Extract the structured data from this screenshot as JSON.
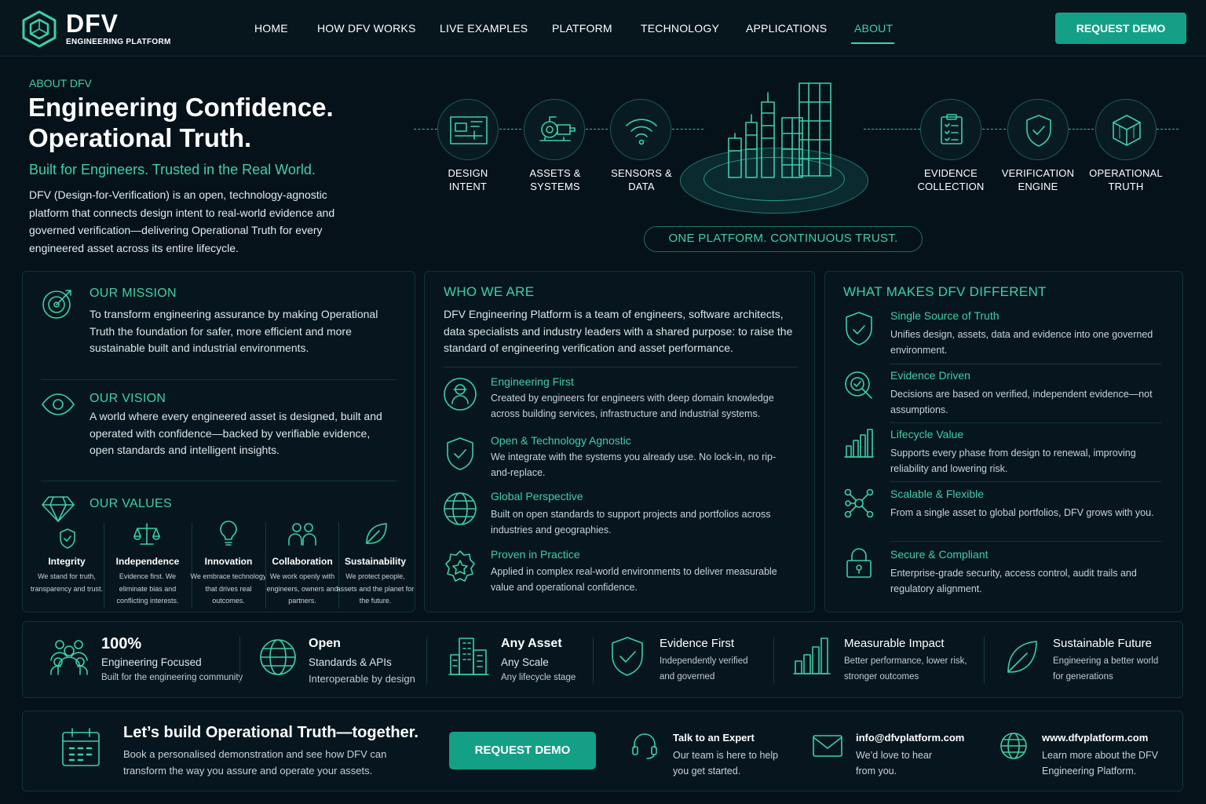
{
  "header": {
    "brand": "DFV",
    "brand_sub": "ENGINEERING PLATFORM",
    "nav": [
      "HOME",
      "HOW DFV WORKS",
      "LIVE EXAMPLES",
      "PLATFORM",
      "TECHNOLOGY",
      "APPLICATIONS",
      "ABOUT"
    ],
    "active_nav": "ABOUT",
    "demo_label": "REQUEST DEMO"
  },
  "hero": {
    "eyebrow": "ABOUT DFV",
    "title_line1": "Engineering Confidence.",
    "title_line2": "Operational Truth.",
    "tagline": "Built for Engineers. Trusted in the Real World.",
    "intro": "DFV (Design-for-Verification) is an open, technology-agnostic platform that connects design intent to real-world evidence and governed verification—delivering Operational Truth for every engineered asset across its entire lifecycle."
  },
  "flow": {
    "steps": [
      {
        "line1": "DESIGN",
        "line2": "INTENT",
        "icon": "blueprint-icon"
      },
      {
        "line1": "ASSETS &",
        "line2": "SYSTEMS",
        "icon": "pump-icon"
      },
      {
        "line1": "SENSORS &",
        "line2": "DATA",
        "icon": "wifi-icon"
      },
      {
        "line1": "EVIDENCE",
        "line2": "COLLECTION",
        "icon": "clipboard-icon"
      },
      {
        "line1": "VERIFICATION",
        "line2": "ENGINE",
        "icon": "shield-check-icon"
      },
      {
        "line1": "OPERATIONAL",
        "line2": "TRUTH",
        "icon": "cube-icon"
      }
    ],
    "banner": "ONE PLATFORM. CONTINUOUS TRUST."
  },
  "mission": {
    "title": "OUR MISSION",
    "text": "To transform engineering assurance by making Operational Truth the foundation for safer, more efficient and more sustainable built and industrial environments."
  },
  "vision": {
    "title": "OUR VISION",
    "text": "A world where every engineered asset is designed, built and operated with confidence—backed by verifiable evidence, open standards and intelligent insights."
  },
  "values": {
    "title": "OUR VALUES",
    "items": [
      {
        "title": "Integrity",
        "desc": "We stand for truth, transparency and trust."
      },
      {
        "title": "Independence",
        "desc": "Evidence first. We eliminate bias and conflicting interests."
      },
      {
        "title": "Innovation",
        "desc": "We embrace technology that drives real outcomes."
      },
      {
        "title": "Collaboration",
        "desc": "We work openly with engineers, owners and partners."
      },
      {
        "title": "Sustainability",
        "desc": "We protect people, assets and the planet for the future."
      }
    ]
  },
  "who": {
    "title": "WHO WE ARE",
    "text": "DFV Engineering Platform is a team of engineers, software architects, data specialists and industry leaders with a shared purpose: to raise the standard of engineering verification and asset performance.",
    "items": [
      {
        "title": "Engineering First",
        "desc": "Created by engineers for engineers with deep domain knowledge across building services, infrastructure and industrial systems."
      },
      {
        "title": "Open & Technology Agnostic",
        "desc": "We integrate with the systems you already use. No lock-in, no rip-and-replace."
      },
      {
        "title": "Global Perspective",
        "desc": "Built on open standards to support projects and portfolios across industries and geographies."
      },
      {
        "title": "Proven in Practice",
        "desc": "Applied in complex real-world environments to deliver measurable value and operational confidence."
      }
    ]
  },
  "different": {
    "title": "WHAT MAKES DFV DIFFERENT",
    "items": [
      {
        "title": "Single Source of Truth",
        "desc": "Unifies design, assets, data and evidence into one governed environment."
      },
      {
        "title": "Evidence Driven",
        "desc": "Decisions are based on verified, independent evidence—not assumptions."
      },
      {
        "title": "Lifecycle Value",
        "desc": "Supports every phase from design to renewal, improving reliability and lowering risk."
      },
      {
        "title": "Scalable & Flexible",
        "desc": "From a single asset to global portfolios, DFV grows with you."
      },
      {
        "title": "Secure & Compliant",
        "desc": "Enterprise-grade security, access control, audit trails and regulatory alignment."
      }
    ]
  },
  "stats": [
    {
      "big": "100%",
      "mid": "Engineering Focused",
      "small": "Built for the engineering community"
    },
    {
      "big": "Open",
      "mid": "Standards & APIs",
      "small": "Interoperable by design"
    },
    {
      "big": "Any Asset",
      "mid": "Any Scale",
      "small": "Any lifecycle stage"
    },
    {
      "big": "Evidence First",
      "mid": "Independently verified",
      "small": "and governed"
    },
    {
      "big": "Measurable Impact",
      "mid": "Better performance, lower risk,",
      "small": "stronger outcomes"
    },
    {
      "big": "Sustainable Future",
      "mid": "Engineering a better world",
      "small": "for generations"
    }
  ],
  "cta": {
    "title": "Let’s build Operational Truth—together.",
    "desc": "Book a personalised demonstration and see how DFV can transform the way you assure and operate your assets.",
    "button": "REQUEST DEMO",
    "contacts": [
      {
        "title": "Talk to an Expert",
        "desc": "Our team is here to help you get started."
      },
      {
        "title": "info@dfvplatform.com",
        "desc": "We’d love to hear from you."
      },
      {
        "title": "www.dfvplatform.com",
        "desc": "Learn more about the DFV Engineering Platform."
      }
    ]
  },
  "colors": {
    "accent": "#3fd0a6",
    "button": "#13a087",
    "background": "#06121a"
  }
}
